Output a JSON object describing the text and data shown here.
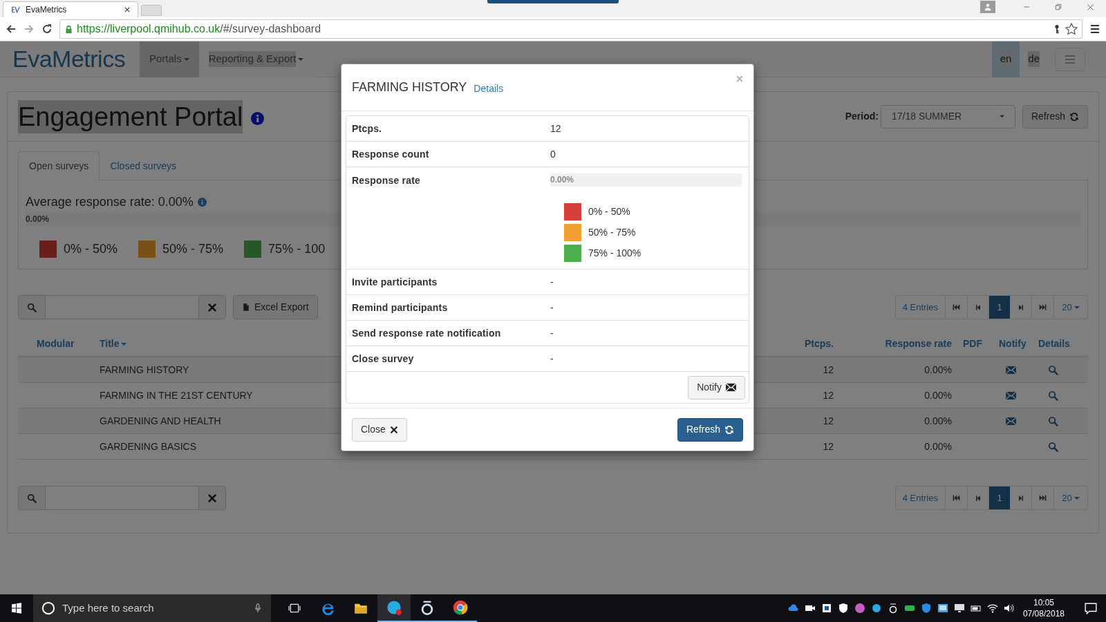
{
  "browser": {
    "tab_title": "EvaMetrics",
    "url_host": "https://liverpool.qmihub.co.uk",
    "url_path": "/#/survey-dashboard"
  },
  "navbar": {
    "logo": "EvaMetrics",
    "menus": [
      {
        "label": "Portals",
        "selected": true
      },
      {
        "label": "Reporting & Export",
        "selected": false
      }
    ],
    "languages": [
      {
        "label": "en",
        "selected": true
      },
      {
        "label": "de",
        "selected": false
      }
    ]
  },
  "header": {
    "title": "Engagement Portal",
    "period_label": "Period:",
    "period_value": "17/18 SUMMER",
    "refresh": "Refresh"
  },
  "tabs": [
    {
      "label": "Open surveys",
      "selected": true
    },
    {
      "label": "Closed surveys",
      "selected": false
    }
  ],
  "summary": {
    "text": "Average response rate: 0.00%",
    "bar_label": "0.00%",
    "level": 0,
    "legend": [
      {
        "label": "0% - 50%",
        "color": "#6a1f1d"
      },
      {
        "label": "50% - 75%",
        "color": "#785018"
      },
      {
        "label": "75% - 100",
        "color": "#265726"
      }
    ]
  },
  "toolbar": {
    "excel_export": "Excel Export",
    "entries": "4 Entries",
    "page": "1",
    "page_size": "20"
  },
  "table": {
    "columns": [
      "Modular",
      "Title",
      "Ptcps.",
      "Response rate",
      "PDF",
      "Notify",
      "Details"
    ],
    "rows": [
      {
        "title": "FARMING HISTORY",
        "ptcps": "12",
        "rate": "0.00%",
        "notify": true
      },
      {
        "title": "FARMING IN THE 21ST CENTURY",
        "ptcps": "12",
        "rate": "0.00%",
        "notify": true
      },
      {
        "title": "GARDENING AND HEALTH",
        "ptcps": "12",
        "rate": "0.00%",
        "notify": true
      },
      {
        "title": "GARDENING BASICS",
        "ptcps": "12",
        "rate": "0.00%",
        "notify": false
      }
    ]
  },
  "bottom_toolbar": {
    "entries": "4 Entries",
    "page": "1",
    "page_size": "20"
  },
  "modal": {
    "title": "FARMING HISTORY",
    "subtitle": "Details",
    "rows": [
      {
        "kind": "text",
        "label": "Ptcps.",
        "value": "12"
      },
      {
        "kind": "text",
        "label": "Response count",
        "value": "0"
      },
      {
        "kind": "rate",
        "label": "Response rate",
        "bar_label": "0.00%",
        "level": 0,
        "legend": [
          {
            "label": "0% - 50%",
            "color": "#d43f3a"
          },
          {
            "label": "50% - 75%",
            "color": "#f0a030"
          },
          {
            "label": "75% - 100%",
            "color": "#4cae4c"
          }
        ]
      },
      {
        "kind": "text",
        "label": "Invite participants",
        "value": "-"
      },
      {
        "kind": "text",
        "label": "Remind participants",
        "value": "-"
      },
      {
        "kind": "text",
        "label": "Send response rate notification",
        "value": "-"
      },
      {
        "kind": "text",
        "label": "Close survey",
        "value": "-"
      }
    ],
    "notify_button": "Notify",
    "close_button": "Close",
    "refresh_button": "Refresh"
  },
  "taskbar": {
    "search_placeholder": "Type here to search",
    "time": "10:05",
    "date": "07/08/2018"
  }
}
